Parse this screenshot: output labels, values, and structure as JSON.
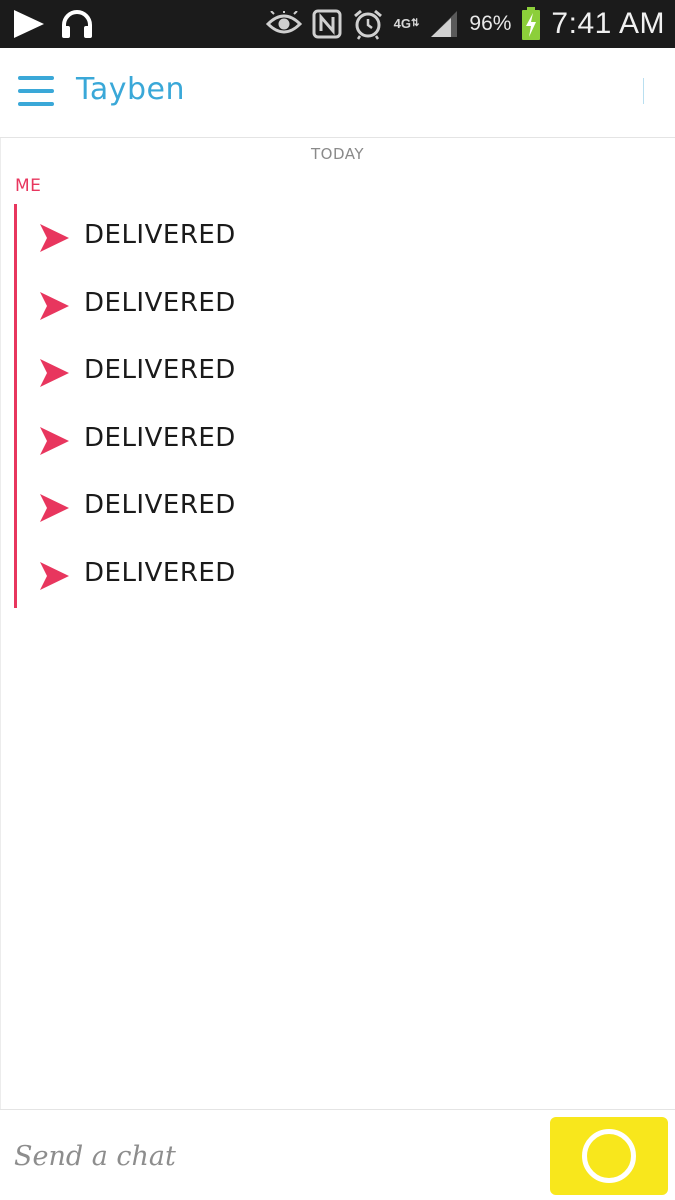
{
  "status_bar": {
    "network_type": "4G",
    "network_arrows": "⇅",
    "battery_percent": "96%",
    "time": "7:41 AM",
    "icons": [
      "play-icon",
      "headphones-icon",
      "eye-icon",
      "nfc-icon",
      "alarm-icon",
      "signal-icon",
      "battery-charging-icon"
    ]
  },
  "header": {
    "contact_name": "Tayben",
    "accent_color": "#3aa8d8"
  },
  "chat": {
    "date_label": "TODAY",
    "sender_label": "ME",
    "sender_color": "#e8365e",
    "messages": [
      {
        "status": "DELIVERED"
      },
      {
        "status": "DELIVERED"
      },
      {
        "status": "DELIVERED"
      },
      {
        "status": "DELIVERED"
      },
      {
        "status": "DELIVERED"
      },
      {
        "status": "DELIVERED"
      }
    ]
  },
  "input_bar": {
    "placeholder": "Send a chat",
    "camera_button_color": "#f8e71c"
  }
}
